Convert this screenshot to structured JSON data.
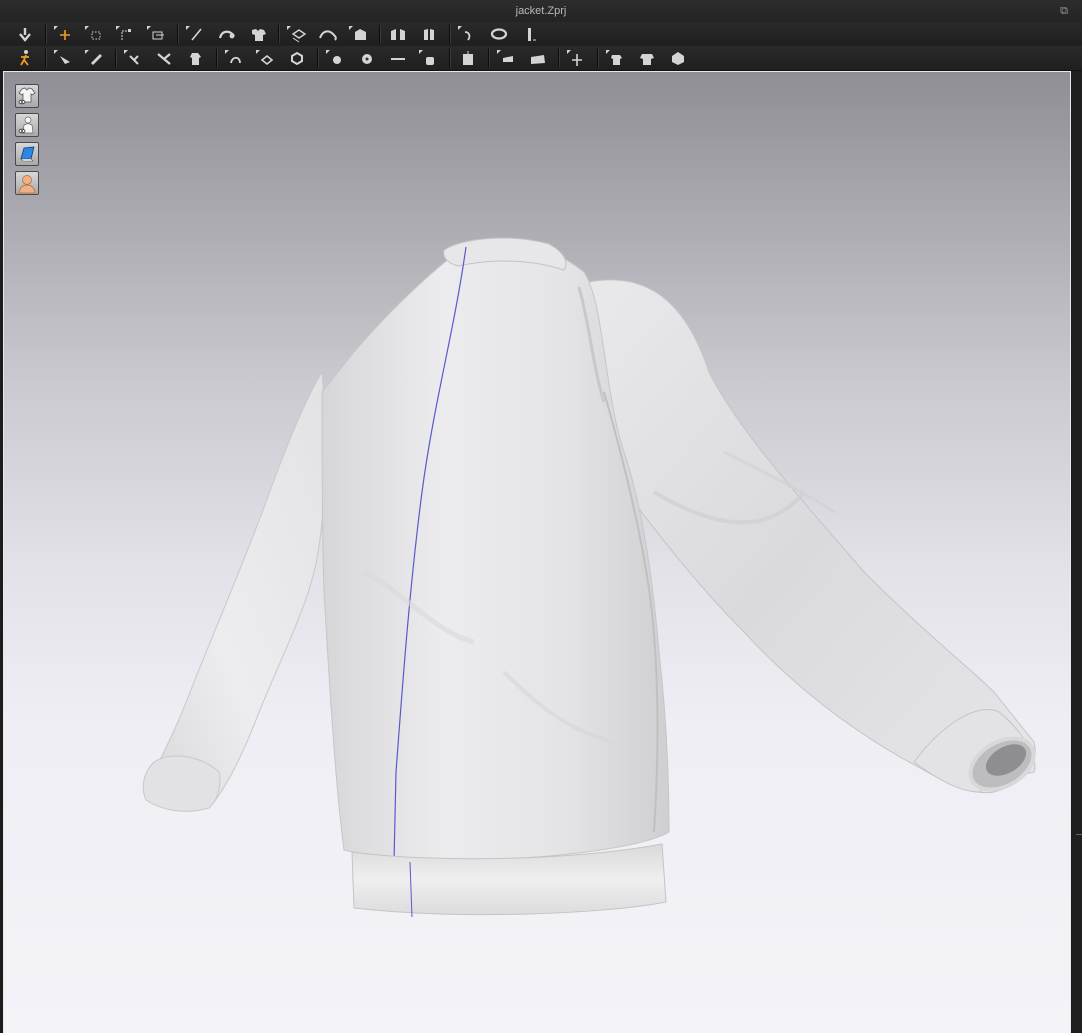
{
  "window": {
    "title": "jacket.Zprj",
    "popout_icon": "popout-icon"
  },
  "toolbar_top": {
    "buttons": [
      "simulate-icon",
      "transform-pattern-icon",
      "transform-point-icon",
      "edit-curvature-icon",
      "trace-icon",
      "segment-sewing-icon",
      "free-sewing-icon",
      "edit-sewing-icon",
      "fold-arrange-icon",
      "tack-icon",
      "strap-icon",
      "flatten-icon",
      "pin-icon",
      "measure-circumference-icon",
      "measure-tape-icon",
      "ruler-icon"
    ]
  },
  "toolbar_bottom": {
    "buttons": [
      "avatar-pose-icon",
      "select-mesh-icon",
      "brush-icon",
      "fold-tool-icon",
      "cut-tool-icon",
      "shirt-edit-icon",
      "topstitch-icon",
      "puckering-icon",
      "stitch-pattern-icon",
      "button-icon",
      "select-button-icon",
      "zipper-icon",
      "buttonhole-icon",
      "hanger-icon",
      "fabric-width-icon",
      "fabric-height-icon",
      "arrange-point-icon",
      "garment-fit-icon",
      "garment-measure-icon",
      "wireframe-icon"
    ]
  },
  "viewport_controls": [
    "show-garment-icon",
    "show-avatar-icon",
    "texture-view-icon",
    "avatar-skin-icon"
  ],
  "colors": {
    "toolbar_bg": "#232323",
    "accent_orange": "#f0a020",
    "viewport_top": "#8e8e94",
    "viewport_bottom": "#f3f3f8",
    "garment": "#ececec",
    "center_seam": "#5a5ac8"
  }
}
